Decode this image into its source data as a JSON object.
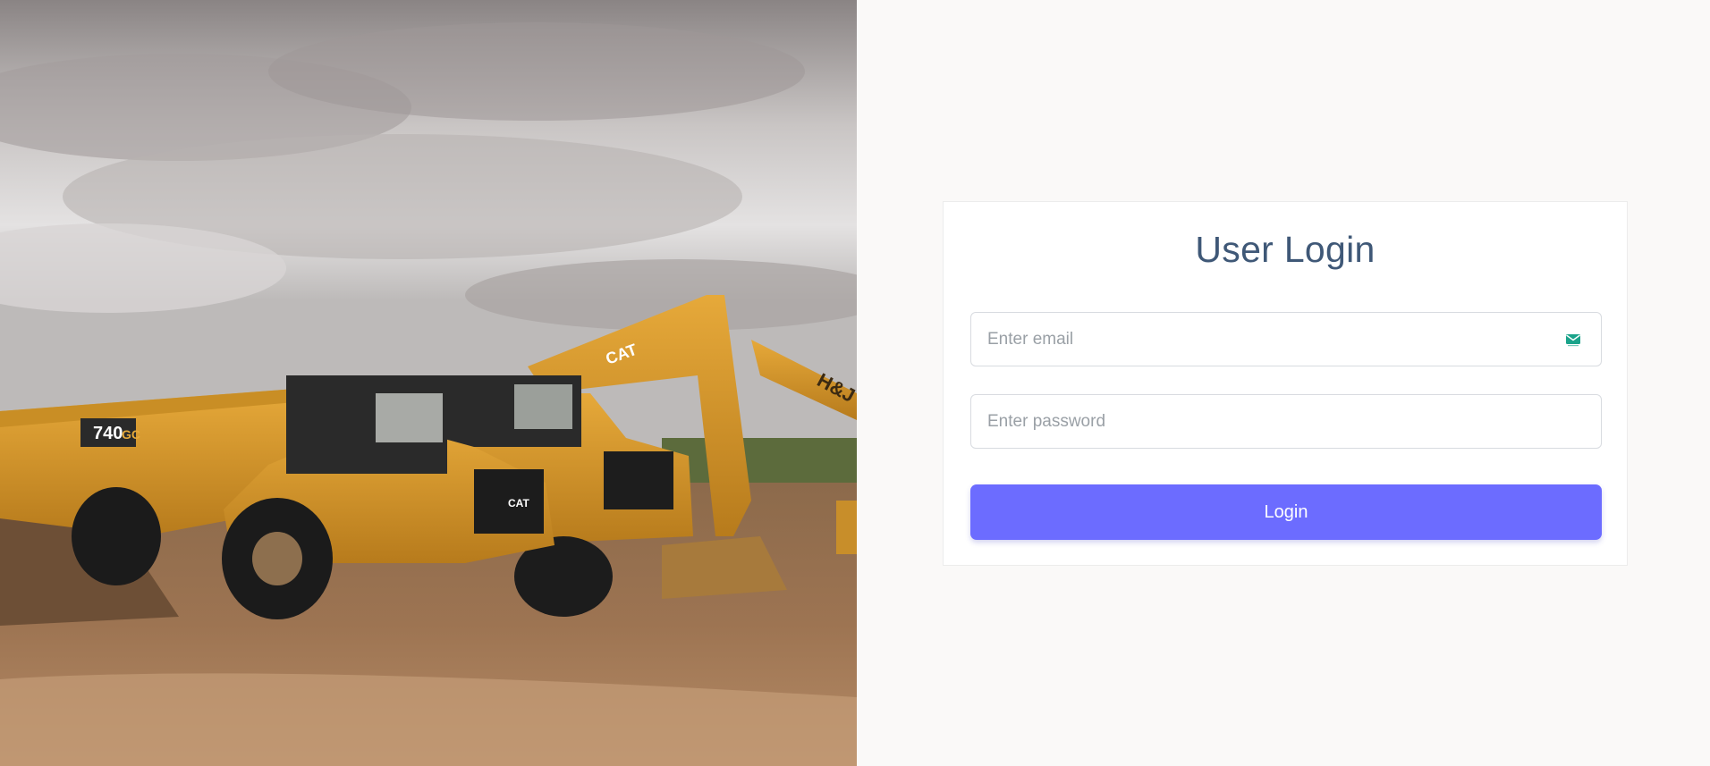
{
  "hero": {
    "image_subject": "construction-site-photo",
    "truck_number": "740",
    "truck_number_suffix": "GC",
    "brand_label": "CAT",
    "excavator_label": "H&J"
  },
  "login": {
    "title": "User Login",
    "email_placeholder": "Enter email",
    "password_placeholder": "Enter password",
    "submit_label": "Login"
  },
  "colors": {
    "accent": "#6c6cff",
    "title": "#3f5877",
    "page_background": "#faf9f8",
    "icon": "#1aa38a"
  },
  "icons": {
    "email": "envelope-icon"
  }
}
